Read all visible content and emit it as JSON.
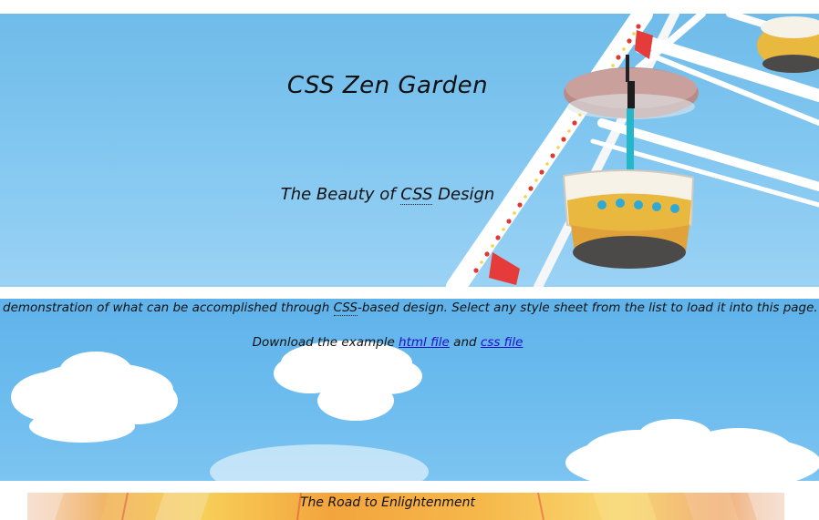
{
  "header": {
    "title": "CSS Zen Garden",
    "tagline_prefix": "The Beauty of ",
    "tagline_abbr": "CSS",
    "tagline_suffix": " Design"
  },
  "intro": {
    "summary_prefix": "demonstration of what can be accomplished through ",
    "summary_abbr": "CSS",
    "summary_suffix": "-based design. Select any style sheet from the list to load it into this page.",
    "download_prefix": "Download the example ",
    "html_link": "html file",
    "download_middle": " and ",
    "css_link": "css file"
  },
  "road": {
    "title": "The Road to Enlightenment"
  },
  "colors": {
    "sky": "#80c6f0",
    "link": "#1a0dcc",
    "text": "#111111"
  }
}
